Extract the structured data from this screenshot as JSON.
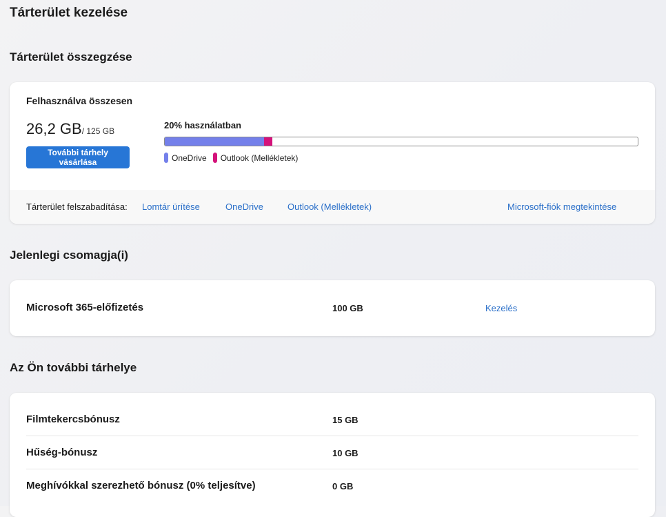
{
  "page": {
    "title": "Tárterület kezelése"
  },
  "summary": {
    "section_title": "Tárterület összegzése",
    "used_label": "Felhasználva összesen",
    "used_amount": "26,2 GB",
    "total_amount": "/ 125 GB",
    "buy_button_label": "További tárhely vásárlása",
    "usage_percent_label": "20% használatban",
    "usage_segments": [
      {
        "name": "OneDrive",
        "fraction": 0.21,
        "color": "#7480ea"
      },
      {
        "name": "Outlook (Mellékletek)",
        "fraction": 0.018,
        "color": "#d4127a"
      }
    ],
    "legend": [
      {
        "label": "OneDrive",
        "color": "#7480ea"
      },
      {
        "label": "Outlook (Mellékletek)",
        "color": "#d4127a"
      }
    ],
    "free_up_label": "Tárterület felszabadítása:",
    "free_up_links": [
      "Lomtár ürítése",
      "OneDrive",
      "Outlook (Mellékletek)"
    ],
    "account_link": "Microsoft-fiók megtekintése"
  },
  "plans": {
    "section_title": "Jelenlegi csomagja(i)",
    "items": [
      {
        "name": "Microsoft 365-előfizetés",
        "size": "100 GB",
        "action": "Kezelés"
      }
    ]
  },
  "additional": {
    "section_title": "Az Ön további tárhelye",
    "items": [
      {
        "name": "Filmtekercsbónusz",
        "size": "15 GB"
      },
      {
        "name": "Hűség-bónusz",
        "size": "10 GB"
      },
      {
        "name": "Meghívókkal szerezhető bónusz (0% teljesítve)",
        "size": "0 GB"
      }
    ]
  }
}
